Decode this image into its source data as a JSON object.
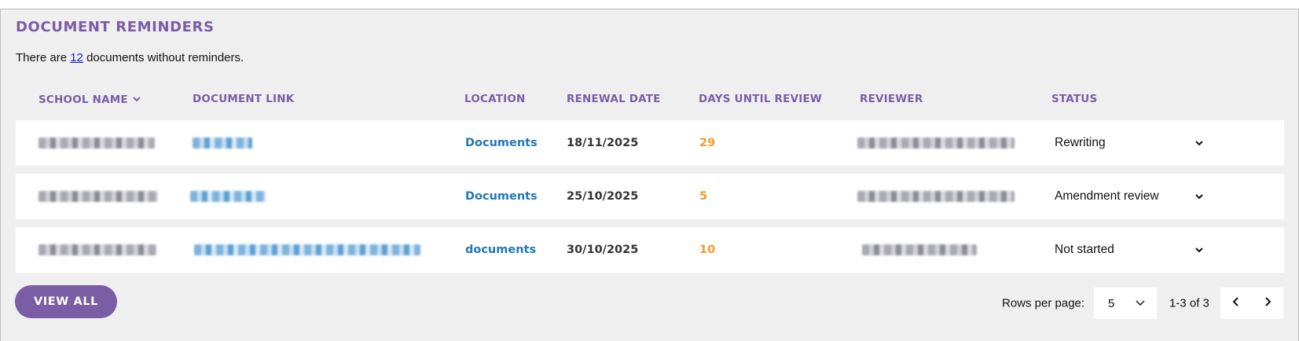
{
  "section": {
    "title": "DOCUMENT REMINDERS",
    "summary_prefix": "There are",
    "summary_count": "12",
    "summary_suffix": "documents without reminders."
  },
  "table": {
    "columns": [
      "SCHOOL NAME",
      "DOCUMENT LINK",
      "LOCATION",
      "RENEWAL DATE",
      "DAYS UNTIL REVIEW",
      "REVIEWER",
      "STATUS"
    ],
    "sort_icon": "chevron-down-icon",
    "rows": [
      {
        "location": "Documents",
        "renewal_date": "18/11/2025",
        "days_until_review": "29",
        "status": "Rewriting"
      },
      {
        "location": "Documents",
        "renewal_date": "25/10/2025",
        "days_until_review": "5",
        "status": "Amendment review"
      },
      {
        "location": "documents",
        "renewal_date": "30/10/2025",
        "days_until_review": "10",
        "status": "Not started"
      }
    ]
  },
  "footer": {
    "view_all_label": "VIEW ALL",
    "rows_per_page_label": "Rows per page:",
    "rows_per_page_value": "5",
    "range": "1-3 of 3",
    "prev_icon": "chevron-left-icon",
    "next_icon": "chevron-right-icon"
  },
  "colors": {
    "accent": "#7b5da6",
    "link": "#1f78b4",
    "days": "#f39a26",
    "panel_bg": "#efefef"
  }
}
